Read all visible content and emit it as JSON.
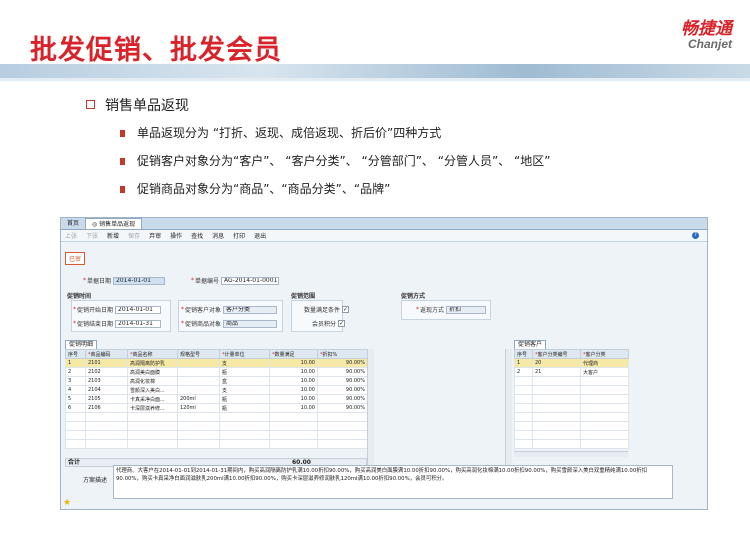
{
  "slide": {
    "title": "批发促销、批发会员",
    "logo_cn": "畅捷通",
    "logo_en": "Chanjet",
    "main_bullet": "销售单品返现",
    "sub_bullets": [
      "单品返现分为 “打折、返现、成倍返现、折后价”四种方式",
      "促销客户对象分为“客户”、 “客户分类”、 “分管部门”、 “分管人员”、 “地区”",
      "促销商品对象分为“商品”、“商品分类”、“品牌”"
    ]
  },
  "app": {
    "tabs": [
      "首页",
      "销售单品返现"
    ],
    "toolbar": [
      "上张",
      "下张",
      "新增",
      "保存",
      "弃审",
      "操作",
      "查找",
      "消息",
      "打印",
      "退出"
    ],
    "status": "已审",
    "doc_date_label": "单据日期",
    "doc_date": "2014-01-01",
    "doc_no_label": "单据编号",
    "doc_no": "AG-2014-01-0001",
    "section_time": "促销时间",
    "start_label": "促销开始日期",
    "start_date": "2014-01-01",
    "end_label": "促销结束日期",
    "end_date": "2014-01-31",
    "cust_obj_label": "促销客户对象",
    "cust_obj": "客户分类",
    "goods_obj_label": "促销商品对象",
    "goods_obj": "商品",
    "section_range": "促销范围",
    "qty_cond_label": "数量满足条件",
    "member_points_label": "会员积分",
    "section_method": "促销方式",
    "method_label": "返现方式",
    "method": "折扣",
    "grid_tab": "促销明细",
    "grid_headers": [
      "序号",
      "商品编码",
      "商品名称",
      "规格型号",
      "计量单位",
      "数量满足",
      "折扣%"
    ],
    "grid_rows": [
      [
        "1",
        "2101",
        "高润隔离防护乳",
        "",
        "支",
        "10.00",
        "90.00%"
      ],
      [
        "2",
        "2102",
        "高润美白面膜",
        "",
        "瓶",
        "10.00",
        "90.00%"
      ],
      [
        "3",
        "2103",
        "高润化妆棉",
        "",
        "盒",
        "10.00",
        "90.00%"
      ],
      [
        "4",
        "2104",
        "雪颜深入美白...",
        "",
        "支",
        "10.00",
        "90.00%"
      ],
      [
        "5",
        "2105",
        "卡真采净白面...",
        "200ml",
        "瓶",
        "10.00",
        "90.00%"
      ],
      [
        "6",
        "2106",
        "卡深层滋养修...",
        "120ml",
        "瓶",
        "10.00",
        "90.00%"
      ]
    ],
    "total_label": "合计",
    "total_qty": "60.00",
    "cust_tab": "促销客户",
    "cust_headers": [
      "序号",
      "客户分类编号",
      "客户分类"
    ],
    "cust_rows": [
      [
        "1",
        "20",
        "代理商"
      ],
      [
        "2",
        "21",
        "大客户"
      ]
    ],
    "desc_label": "方案描述",
    "desc_text": "代理商、大客户在2014-01-01到2014-01-31期间内，购买高润隔离防护乳满10.00折扣90.00%，购买高润美白面膜满10.00折扣90.00%，购买高润化妆棉满10.00折扣90.00%，购买雪颜深入美白双重精纯满10.00折扣90.00%，购买卡真采净白面润滋肤乳200ml满10.00折扣90.00%，购买卡深层滋养修润肤乳120ml满10.00折扣90.00%，会员可积分。"
  }
}
